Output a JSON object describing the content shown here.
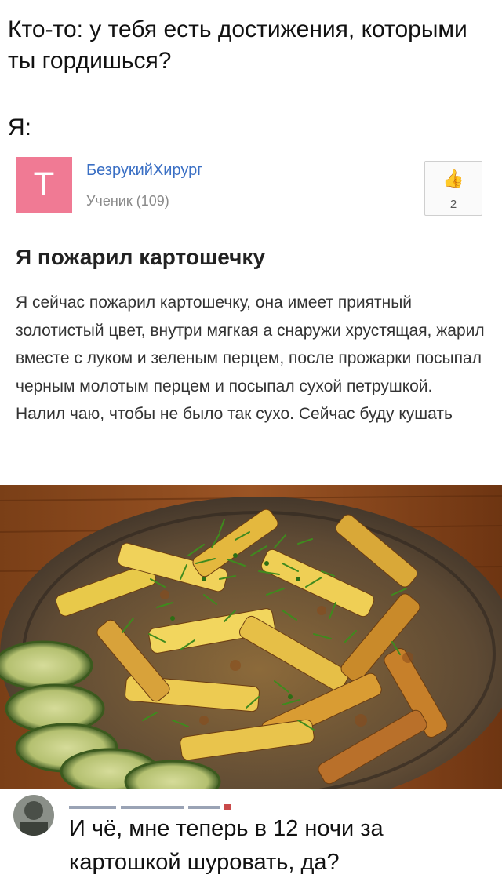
{
  "meme": {
    "question": "Кто-то: у тебя есть достижения, которыми ты гордишься?",
    "answer_label": "Я:"
  },
  "post": {
    "avatar_letter": "T",
    "author": "БезрукийХирург",
    "rank": "Ученик (109)",
    "likes": "2",
    "title": "Я пожарил картошечку",
    "body": "Я сейчас пожарил картошечку, она имеет приятный золотистый цвет, внутри мягкая а снаружи хрустящая, жарил вместе с луком и зеленым перцем, после прожарки посыпал черным молотым перцем и посыпал сухой петрушкой. Налил чаю, чтобы не было так сухо. Сейчас буду кушать"
  },
  "comment": {
    "text": "И чё, мне теперь в 12 ночи за картошкой шуровать, да?"
  },
  "icons": [
    "thumbs-up-icon"
  ],
  "colors": {
    "avatar_bg": "#f07a94",
    "author_link": "#3a6fc4",
    "rank_gray": "#8a8a8a"
  }
}
